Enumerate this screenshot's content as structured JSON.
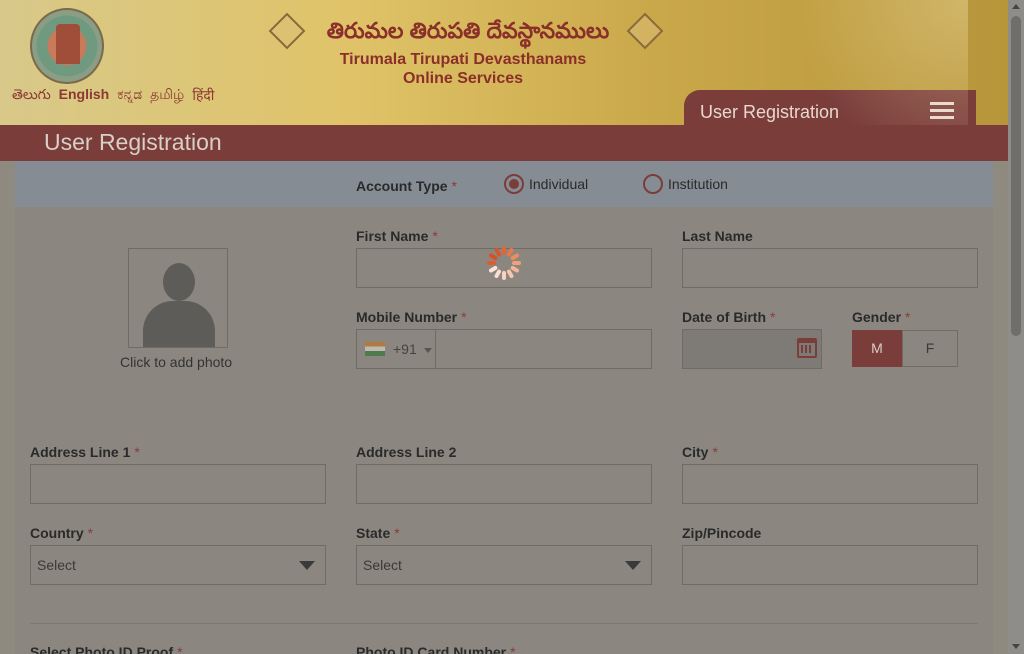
{
  "header": {
    "languages": [
      {
        "label": "తెలుగు"
      },
      {
        "label": "English",
        "active": true
      },
      {
        "label": "ಕನ್ನಡ"
      },
      {
        "label": "தமிழ்"
      },
      {
        "label": "हिंदी"
      }
    ],
    "title_telugu": "తిరుమల తిరుపతి దేవస్థానములు",
    "title_line1": "Tirumala Tirupati Devasthanams",
    "title_line2": "Online Services",
    "nav_label": "User Registration",
    "menu_icon": "hamburger-icon"
  },
  "page_title": "User Registration",
  "form": {
    "account_type": {
      "label": "Account Type",
      "options": [
        {
          "label": "Individual",
          "checked": true
        },
        {
          "label": "Institution",
          "checked": false
        }
      ]
    },
    "photo_caption": "Click to add photo",
    "first_name": {
      "label": "First Name",
      "value": ""
    },
    "last_name": {
      "label": "Last Name",
      "value": ""
    },
    "mobile": {
      "label": "Mobile Number",
      "country_code": "+91",
      "value": ""
    },
    "dob": {
      "label": "Date of Birth",
      "value": ""
    },
    "gender": {
      "label": "Gender",
      "options": [
        "M",
        "F"
      ],
      "selected": "M"
    },
    "address1": {
      "label": "Address Line 1",
      "value": ""
    },
    "address2": {
      "label": "Address Line 2",
      "value": ""
    },
    "city": {
      "label": "City",
      "value": ""
    },
    "country": {
      "label": "Country",
      "value": "Select"
    },
    "state": {
      "label": "State",
      "value": "Select"
    },
    "zip": {
      "label": "Zip/Pincode",
      "value": ""
    },
    "photo_id_proof": {
      "label": "Select Photo ID Proof"
    },
    "photo_id_number": {
      "label": "Photo ID Card Number"
    },
    "required_mark": "*"
  },
  "colors": {
    "brand": "#7a3d3a",
    "accent_text": "#8a2f2a"
  }
}
